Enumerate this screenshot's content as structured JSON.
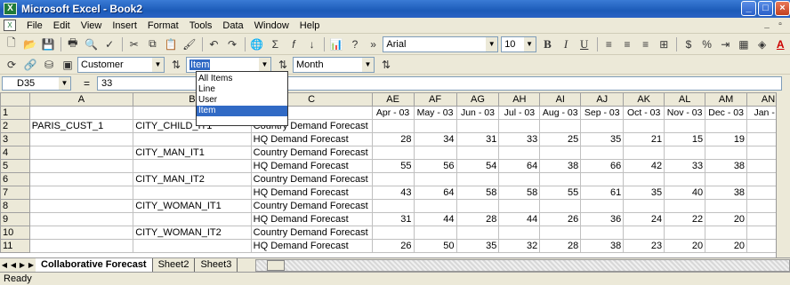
{
  "window": {
    "title": "Microsoft Excel - Book2"
  },
  "menu": [
    "File",
    "Edit",
    "View",
    "Insert",
    "Format",
    "Tools",
    "Data",
    "Window",
    "Help"
  ],
  "toolbar": {
    "font": "Arial",
    "size": "10"
  },
  "olap": {
    "dim1": "Customer",
    "dim2": "Item",
    "dim3": "Month"
  },
  "dropdown": {
    "options": [
      "All Items",
      "Line",
      "User",
      "Item"
    ],
    "selected": "Item"
  },
  "formula": {
    "cell": "D35",
    "value": "33"
  },
  "grid": {
    "col_letters": [
      "A",
      "B",
      "C",
      "AE",
      "AF",
      "AG",
      "AH",
      "AI",
      "AJ",
      "AK",
      "AL",
      "AM",
      "AN"
    ],
    "months": [
      "Apr - 03",
      "May - 03",
      "Jun - 03",
      "Jul - 03",
      "Aug - 03",
      "Sep - 03",
      "Oct - 03",
      "Nov - 03",
      "Dec - 03",
      "Jan - 0"
    ],
    "rows": [
      {
        "n": "2",
        "a": "PARIS_CUST_1",
        "b": "CITY_CHILD_IT1",
        "c": "Country Demand Forecast",
        "v": [
          "",
          "",
          "",
          "",
          "",
          "",
          "",
          "",
          "",
          ""
        ]
      },
      {
        "n": "3",
        "a": "",
        "b": "",
        "c": "HQ Demand Forecast",
        "v": [
          "28",
          "34",
          "31",
          "33",
          "25",
          "35",
          "21",
          "15",
          "19",
          "1"
        ]
      },
      {
        "n": "4",
        "a": "",
        "b": "CITY_MAN_IT1",
        "c": "Country Demand Forecast",
        "v": [
          "",
          "",
          "",
          "",
          "",
          "",
          "",
          "",
          "",
          ""
        ]
      },
      {
        "n": "5",
        "a": "",
        "b": "",
        "c": "HQ Demand Forecast",
        "v": [
          "55",
          "56",
          "54",
          "64",
          "38",
          "66",
          "42",
          "33",
          "38",
          "2"
        ]
      },
      {
        "n": "6",
        "a": "",
        "b": "CITY_MAN_IT2",
        "c": "Country Demand Forecast",
        "v": [
          "",
          "",
          "",
          "",
          "",
          "",
          "",
          "",
          "",
          ""
        ]
      },
      {
        "n": "7",
        "a": "",
        "b": "",
        "c": "HQ Demand Forecast",
        "v": [
          "43",
          "64",
          "58",
          "58",
          "55",
          "61",
          "35",
          "40",
          "38",
          "2"
        ]
      },
      {
        "n": "8",
        "a": "",
        "b": "CITY_WOMAN_IT1",
        "c": "Country Demand Forecast",
        "v": [
          "",
          "",
          "",
          "",
          "",
          "",
          "",
          "",
          "",
          ""
        ]
      },
      {
        "n": "9",
        "a": "",
        "b": "",
        "c": "HQ Demand Forecast",
        "v": [
          "31",
          "44",
          "28",
          "44",
          "26",
          "36",
          "24",
          "22",
          "20",
          "1"
        ]
      },
      {
        "n": "10",
        "a": "",
        "b": "CITY_WOMAN_IT2",
        "c": "Country Demand Forecast",
        "v": [
          "",
          "",
          "",
          "",
          "",
          "",
          "",
          "",
          "",
          ""
        ]
      },
      {
        "n": "11",
        "a": "",
        "b": "",
        "c": "HQ Demand Forecast",
        "v": [
          "26",
          "50",
          "35",
          "32",
          "28",
          "38",
          "23",
          "20",
          "20",
          "1"
        ]
      }
    ]
  },
  "sheets": [
    "Collaborative Forecast",
    "Sheet2",
    "Sheet3"
  ],
  "status": "Ready"
}
